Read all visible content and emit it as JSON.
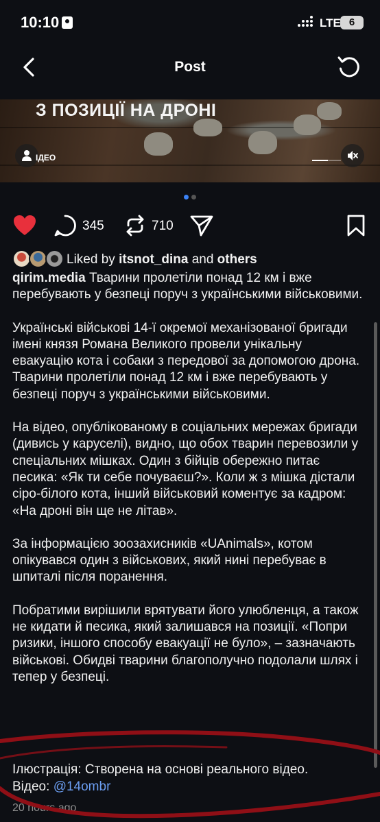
{
  "status_bar": {
    "time": "10:10",
    "network": "LTE",
    "battery": "6",
    "icons": [
      "id-card-icon",
      "signal-icon"
    ]
  },
  "nav": {
    "title": "Post",
    "back_icon": "chevron-left-icon",
    "refresh_icon": "refresh-icon"
  },
  "media": {
    "caption": "З ПОЗИЦІЇ НА ДРОНІ",
    "tag_label": "ІДЕО",
    "video_progress": 0.55,
    "carousel_pages": 2,
    "carousel_active": 1
  },
  "actions": {
    "liked": true,
    "comments": "345",
    "reposts": "710",
    "icons": [
      "heart-icon",
      "comment-icon",
      "repost-icon",
      "share-icon",
      "bookmark-icon"
    ]
  },
  "liked_by": {
    "prefix": "Liked by",
    "user": "itsnot_dina",
    "and": "and",
    "others": "others"
  },
  "post": {
    "author": "qirim.media",
    "lead": "Тварини пролетіли понад 12 км і вже перебувають у безпеці поруч з українськими військовими.",
    "paragraphs": [
      "Українські військові 14-ї окремої механізованої бригади імені князя Романа Великого провели унікальну евакуацію кота і собаки з передової за допомогою дрона. Тварини пролетіли понад 12 км і вже перебувають у безпеці поруч з українськими військовими.",
      "На відео, опублікованому в соціальних мережах бригади (дивись у каруселі), видно, що обох тварин перевозили у спеціальних мішках. Один з бійців обережно питає песика: «Як ти себе почуваєш?». Коли ж з мішка дістали сіро-білого кота, інший військовий коментує за кадром: «На дроні він ще не літав».",
      "За інформацією зоозахисників «UAnimals», котом опікувався один з військових, який нині перебуває в шпиталі після поранення.",
      "Побратими вирішили врятувати його улюбленця, а також не кидати й песика, який залишався на позиції. «Попри ризики, іншого способу евакуації не було», – зазначають військові. Обидві тварини благополучно подолали шлях і тепер у безпеці."
    ],
    "illustration": "Ілюстрація: Створена на основі реального відео.",
    "video_prefix": "Відео:",
    "video_handle": "@14ombr",
    "timestamp": "20 hours ago"
  },
  "colors": {
    "background": "#0d0f14",
    "like": "#e8303c",
    "link": "#6b9df0",
    "carousel_active": "#3b82f6",
    "annotation": "#8f0f16"
  }
}
